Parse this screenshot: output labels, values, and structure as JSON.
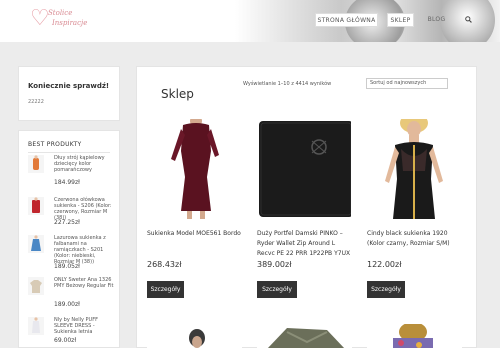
{
  "header": {
    "logo_line1": "Stolice",
    "logo_line2": "Inspiracje",
    "nav": [
      {
        "label": "STRONA GŁÓWNA"
      },
      {
        "label": "SKLEP"
      },
      {
        "label": "BLOG"
      }
    ],
    "search_icon": "search-icon"
  },
  "sidebar": {
    "widget1": {
      "title": "Koniecznie sprawdź!",
      "text": "22222"
    },
    "best": {
      "title": "BEST PRODUKTY",
      "items": [
        {
          "name": "Dłuy strój kąpielowy dziecięcy kolor pomarańczowy",
          "price": "184.99zł"
        },
        {
          "name": "Czerwona ołówkowa sukienka - S206 (Kolor: czerwony, Rozmiar M (38))",
          "price": "227.25zł"
        },
        {
          "name": "Lazurowa sukienka z falbanami na ramiączkach - S201 (Kolor: niebieski, Rozmiar M (38))",
          "price": "189.05zł"
        },
        {
          "name": "ONLY Sweter Ana 1326 PMY Beżowy Regular Fit",
          "price": "189.00zł"
        },
        {
          "name": "Nly by Nelly PUFF SLEEVE DRESS - Sukienka letnia",
          "price": "69.00zł"
        }
      ]
    }
  },
  "main": {
    "title": "Sklep",
    "count_text": "Wyświetlanie 1–10 z 4414 wyników",
    "sort_value": "Sortuj od najnowszych",
    "products": [
      {
        "name": "Sukienka Model MOE561 Bordo",
        "price": "268.43zł",
        "button": "Szczegóły"
      },
      {
        "name": "Duży Portfel Damski PINKO – Ryder Wallet Zip Around L Recvc PE 22 PRR 1P22PB Y7UX",
        "price": "389.00zł",
        "button": "Szczegóły"
      },
      {
        "name": "Cindy black sukienka 1920 (Kolor czarny, Rozmiar S/M)",
        "price": "122.00zł",
        "button": "Szczegóły"
      }
    ]
  },
  "colors": {
    "page_bg": "#ececec",
    "button_bg": "#333333",
    "logo_pink": "#d98b93"
  }
}
